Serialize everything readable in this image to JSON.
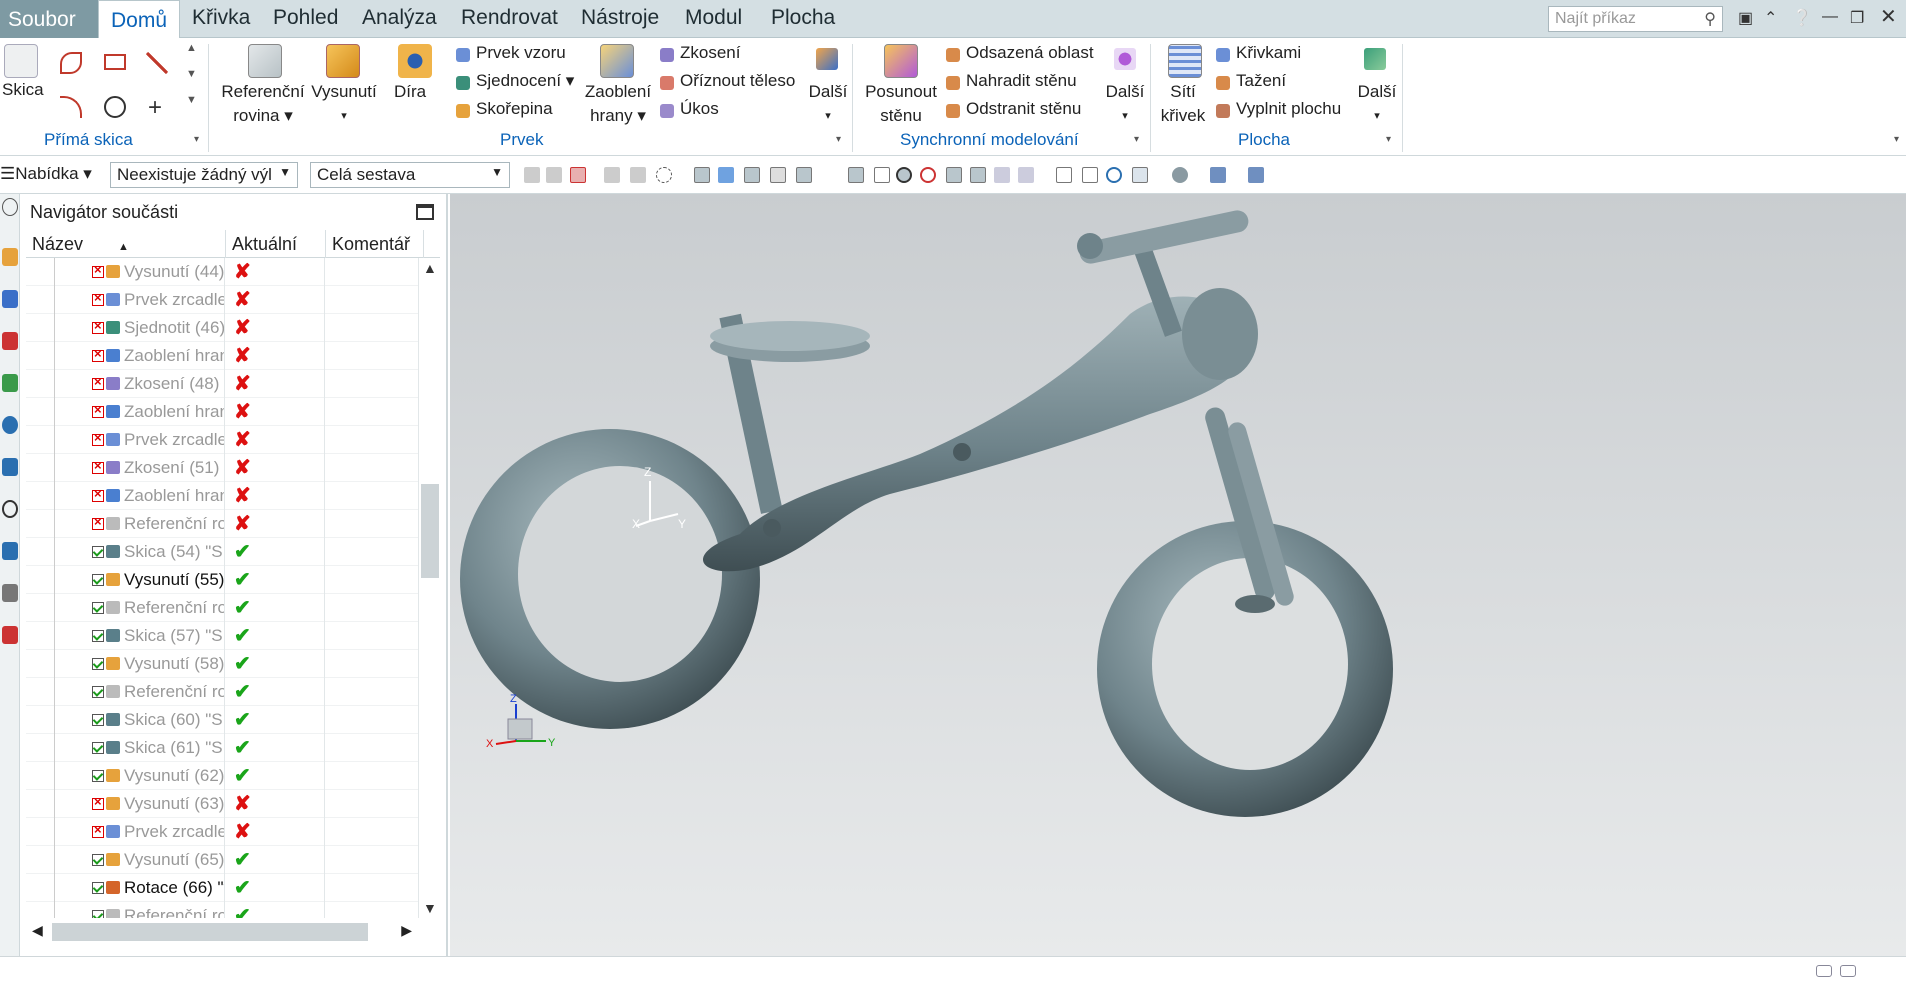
{
  "menu": {
    "file": "Soubor",
    "tabs": [
      "Domů",
      "Křivka",
      "Pohled",
      "Analýza",
      "Rendrovat",
      "Nástroje",
      "Modul",
      "Plocha"
    ],
    "search_placeholder": "Najít příkaz"
  },
  "ribbon": {
    "g1": {
      "skica": "Skica",
      "label": "Přímá skica"
    },
    "g2": {
      "ref_line1": "Referenční",
      "ref_line2": "rovina",
      "vys": "Vysunutí",
      "dira": "Díra",
      "prvek_vzoru": "Prvek vzoru",
      "sjednoceni": "Sjednocení",
      "skorepina": "Skořepina",
      "zaobleni_line1": "Zaoblení",
      "zaobleni_line2": "hrany",
      "zkoseni": "Zkosení",
      "oriznout": "Oříznout těleso",
      "ukos": "Úkos",
      "dalsi": "Další",
      "label": "Prvek"
    },
    "g3": {
      "posunout_line1": "Posunout",
      "posunout_line2": "stěnu",
      "odsazena": "Odsazená oblast",
      "nahradit": "Nahradit stěnu",
      "odstranit": "Odstranit stěnu",
      "dalsi": "Další",
      "label": "Synchronní modelování"
    },
    "g4": {
      "siti_line1": "Sítí",
      "siti_line2": "křivek",
      "krivkami": "Křivkami",
      "tazeni": "Tažení",
      "vyplnit": "Vyplnit plochu",
      "dalsi": "Další",
      "label": "Plocha"
    }
  },
  "toolbar": {
    "nabidka": "Nabídka",
    "filter": "Neexistuje žádný výl",
    "assembly": "Celá sestava"
  },
  "navigator": {
    "title": "Navigátor součásti",
    "headers": {
      "name": "Název",
      "current": "Aktuální",
      "comment": "Komentář"
    },
    "rows": [
      {
        "name": "Vysunutí (44)",
        "ok": false,
        "icon": "#e6a23c"
      },
      {
        "name": "Prvek zrcadle...",
        "ok": false,
        "icon": "#6b8fd6"
      },
      {
        "name": "Sjednotit (46)",
        "ok": false,
        "icon": "#3b8f7a"
      },
      {
        "name": "Zaoblení hran...",
        "ok": false,
        "icon": "#4a7fd0"
      },
      {
        "name": "Zkosení (48)",
        "ok": false,
        "icon": "#8a7dc8"
      },
      {
        "name": "Zaoblení hran...",
        "ok": false,
        "icon": "#4a7fd0"
      },
      {
        "name": "Prvek zrcadle...",
        "ok": false,
        "icon": "#6b8fd6"
      },
      {
        "name": "Zkosení (51)",
        "ok": false,
        "icon": "#8a7dc8"
      },
      {
        "name": "Zaoblení hran...",
        "ok": false,
        "icon": "#4a7fd0"
      },
      {
        "name": "Referenční ro...",
        "ok": false,
        "icon": "#bbbbbb"
      },
      {
        "name": "Skica (54) \"SK...",
        "ok": true,
        "icon": "#5a7f8a"
      },
      {
        "name": "Vysunutí (55)",
        "ok": true,
        "icon": "#e6a23c",
        "active": true
      },
      {
        "name": "Referenční ro...",
        "ok": true,
        "icon": "#bbbbbb"
      },
      {
        "name": "Skica (57) \"SK...",
        "ok": true,
        "icon": "#5a7f8a"
      },
      {
        "name": "Vysunutí (58)",
        "ok": true,
        "icon": "#e6a23c"
      },
      {
        "name": "Referenční ro...",
        "ok": true,
        "icon": "#bbbbbb"
      },
      {
        "name": "Skica (60) \"SK...",
        "ok": true,
        "icon": "#5a7f8a"
      },
      {
        "name": "Skica (61) \"SK...",
        "ok": true,
        "icon": "#5a7f8a"
      },
      {
        "name": "Vysunutí (62)",
        "ok": true,
        "icon": "#e6a23c"
      },
      {
        "name": "Vysunutí (63)",
        "ok": false,
        "icon": "#e6a23c"
      },
      {
        "name": "Prvek zrcadle...",
        "ok": false,
        "icon": "#6b8fd6"
      },
      {
        "name": "Vysunutí (65)",
        "ok": true,
        "icon": "#e6a23c"
      },
      {
        "name": "Rotace (66) \"t...",
        "ok": true,
        "icon": "#d4652a",
        "active": true
      },
      {
        "name": "Referenční ro...",
        "ok": true,
        "icon": "#bbbbbb"
      }
    ]
  },
  "viewport": {
    "axis_z": "Z",
    "axis_y": "Y",
    "axis_x": "X"
  },
  "colors": {
    "accent": "#0b63b8",
    "menubar": "#d4dfe3",
    "model": "#7f9399"
  }
}
